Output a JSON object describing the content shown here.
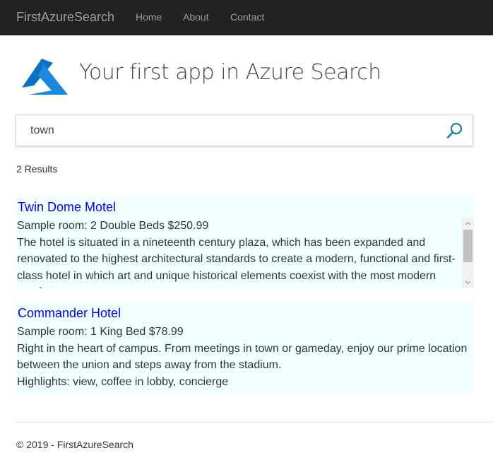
{
  "navbar": {
    "brand": "FirstAzureSearch",
    "links": [
      "Home",
      "About",
      "Contact"
    ]
  },
  "header": {
    "logo_icon": "azure-logo-icon",
    "title": "Your first app in Azure Search"
  },
  "search": {
    "value": "town",
    "button_icon": "search-icon"
  },
  "results": {
    "count_label": "2 Results",
    "items": [
      {
        "name": "Twin Dome Motel",
        "room": "Sample room: 2 Double Beds $250.99",
        "description": "The hotel is situated in a  nineteenth century plaza, which has been expanded and renovated to the highest architectural standards to create a modern, functional and first-class hotel in which art and unique historical elements coexist with the most modern comforts."
      },
      {
        "name": "Commander Hotel",
        "room": "Sample room: 1 King Bed $78.99",
        "description": "Right in the heart of campus.  From meetings in town or gameday, enjoy our prime location between the union and steps away from the stadium.",
        "highlights": "Highlights: view, coffee in lobby, concierge"
      }
    ]
  },
  "footer": {
    "text": "© 2019 - FirstAzureSearch"
  },
  "colors": {
    "navbar": "#222222",
    "result_background": "#f0ffff",
    "link": "#0000ee",
    "search_icon": "#1a7fa0",
    "azure_blue": "#0a72c4"
  }
}
